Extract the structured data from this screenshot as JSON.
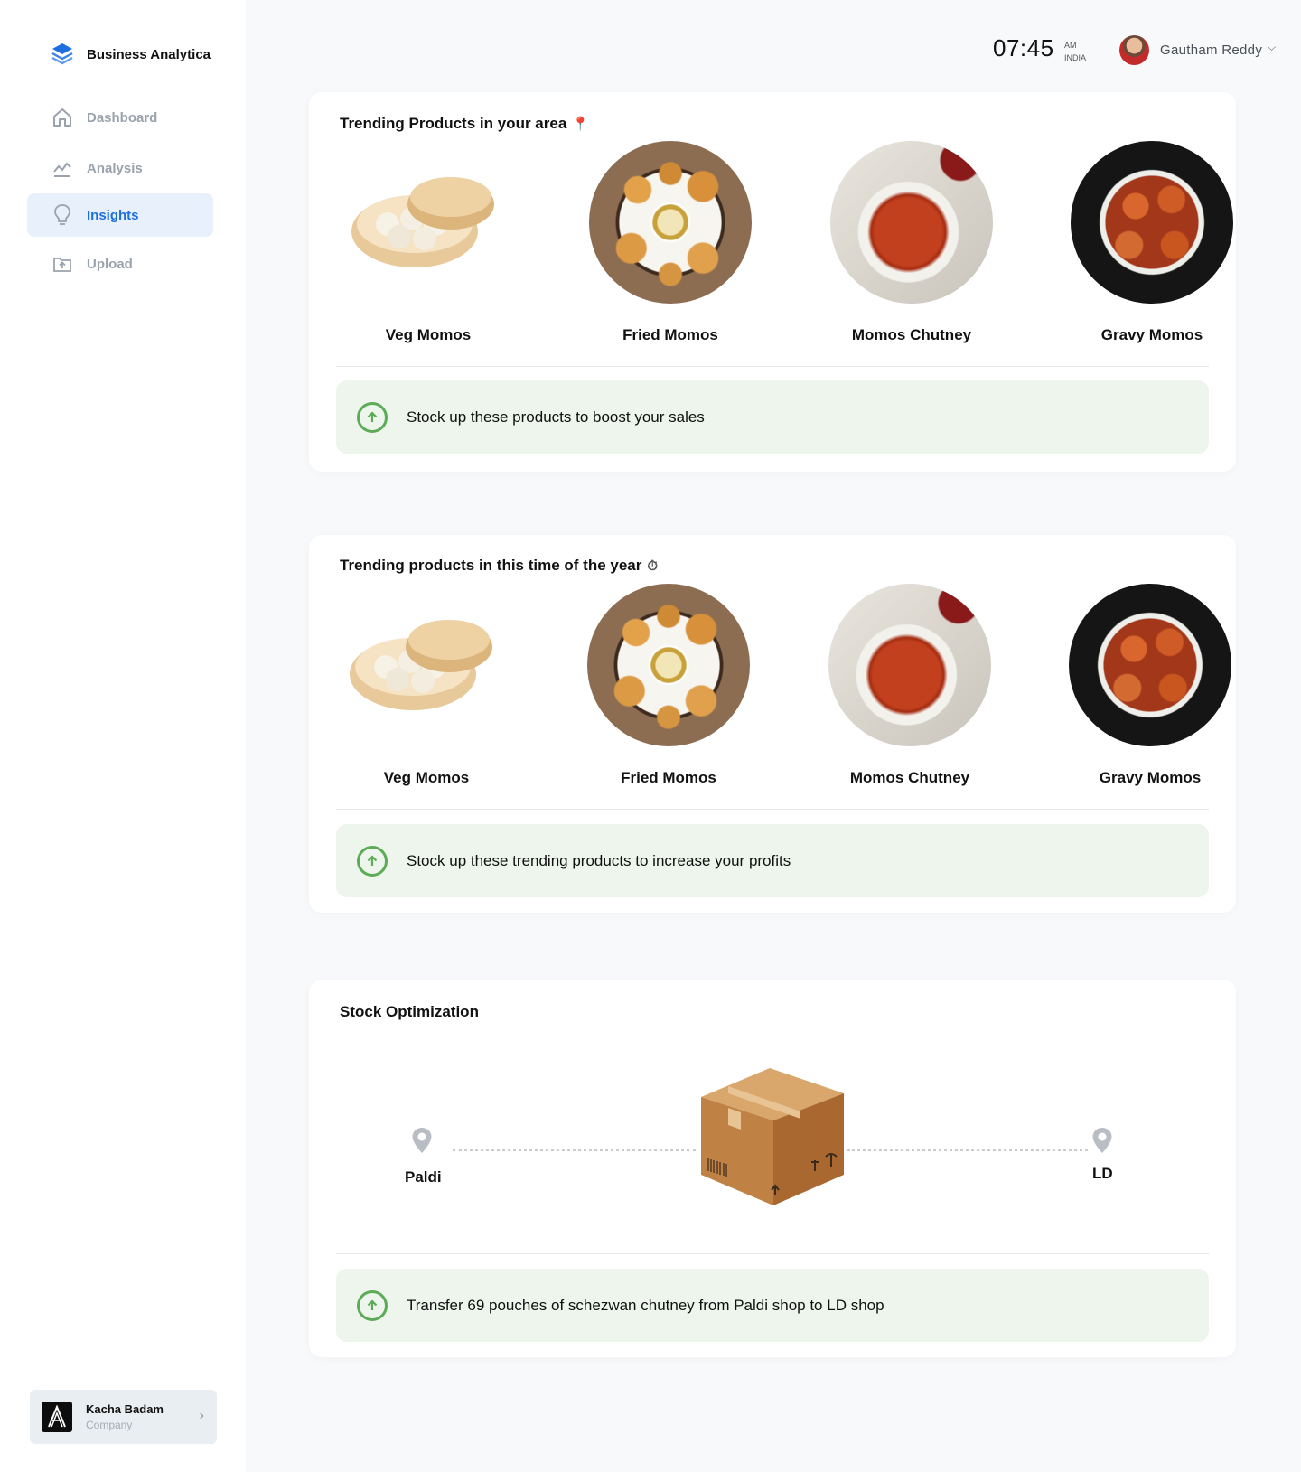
{
  "app": {
    "title": "Business Analytica"
  },
  "sidebar": {
    "items": [
      {
        "label": "Dashboard",
        "icon": "home-icon",
        "active": false
      },
      {
        "label": "Analysis",
        "icon": "chart-line-icon",
        "active": false
      },
      {
        "label": "Insights",
        "icon": "lightbulb-icon",
        "active": true
      },
      {
        "label": "Upload",
        "icon": "upload-folder-icon",
        "active": false
      }
    ],
    "company": {
      "name": "Kacha Badam",
      "subtitle": "Company"
    }
  },
  "header": {
    "time": "07:45",
    "meridiem": "AM",
    "region": "INDIA",
    "user_name": "Gautham Reddy"
  },
  "cards": {
    "area": {
      "title": "Trending Products in your area",
      "title_icon": "📍",
      "products": [
        {
          "name": "Veg Momos",
          "image": "veg-momos-steamer"
        },
        {
          "name": "Fried Momos",
          "image": "fried-momos-plate"
        },
        {
          "name": "Momos Chutney",
          "image": "chutney-bowl"
        },
        {
          "name": "Gravy Momos",
          "image": "gravy-momos-plate"
        }
      ],
      "banner": "Stock up these products to boost your sales"
    },
    "season": {
      "title": "Trending products in this time of the year",
      "title_icon": "⏱",
      "products": [
        {
          "name": "Veg Momos",
          "image": "veg-momos-steamer"
        },
        {
          "name": "Fried Momos",
          "image": "fried-momos-plate"
        },
        {
          "name": "Momos Chutney",
          "image": "chutney-bowl"
        },
        {
          "name": "Gravy Momos",
          "image": "gravy-momos-plate"
        }
      ],
      "banner": "Stock up these trending products to increase your profits"
    },
    "stock": {
      "title": "Stock Optimization",
      "from": "Paldi",
      "to": "LD",
      "banner": "Transfer 69 pouches of schezwan chutney from Paldi shop to LD shop"
    }
  },
  "colors": {
    "accent": "#1d6fe0",
    "active_nav_bg": "#e8f0fc",
    "banner_bg": "#edf5ec",
    "banner_icon": "#5cab57"
  }
}
